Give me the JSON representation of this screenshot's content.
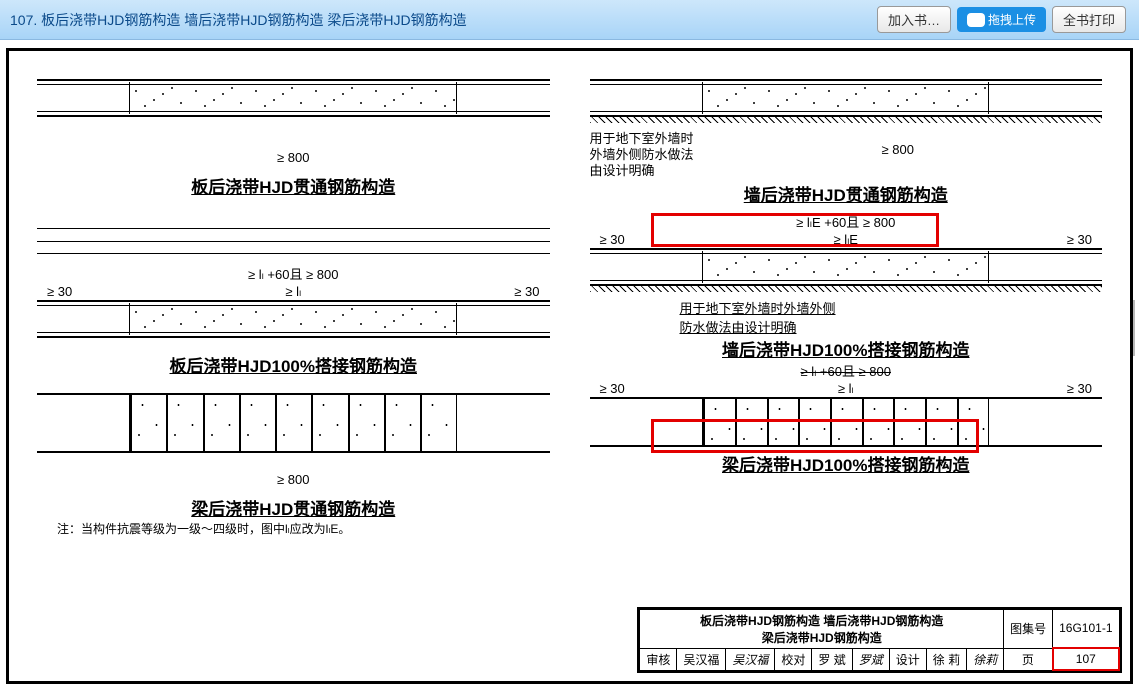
{
  "toolbar": {
    "title": "107.  板后浇带HJD钢筋构造   墙后浇带HJD钢筋构造   梁后浇带HJD钢筋构造",
    "add_label": "加入书…",
    "cloud_label": "拖拽上传",
    "print_label": "全书打印"
  },
  "left": {
    "dim_800": "≥ 800",
    "title1": "板后浇带HJD贯通钢筋构造",
    "dim_ll60800": "≥ lₗ +60且 ≥ 800",
    "dim_ll": "≥ lₗ",
    "dim_30a": "≥ 30",
    "dim_30b": "≥ 30",
    "title2": "板后浇带HJD100%搭接钢筋构造",
    "dim_800b": "≥ 800",
    "title3": "梁后浇带HJD贯通钢筋构造",
    "footnote": "注：当构件抗震等级为一级～四级时，图中lₗ应改为lₗE。"
  },
  "right": {
    "note1a": "用于地下室外墙时",
    "note1b": "外墙外侧防水做法",
    "note1c": "由设计明确",
    "dim_800": "≥ 800",
    "title1": "墙后浇带HJD贯通钢筋构造",
    "dim_llE60800": "≥ lₗE +60且 ≥ 800",
    "dim_llE": "≥ lₗE",
    "dim_30a": "≥ 30",
    "dim_30b": "≥ 30",
    "note2a": "用于地下室外墙时外墙外侧",
    "note2b": "防水做法由设计明确",
    "title2": "墙后浇带HJD100%搭接钢筋构造",
    "dim_ll60800b": "≥ lₗ +60且 ≥ 800",
    "dim_ll": "≥ lₗ",
    "dim_30c": "≥ 30",
    "dim_30d": "≥ 30",
    "title3": "梁后浇带HJD100%搭接钢筋构造"
  },
  "title_block": {
    "row1a": "板后浇带HJD钢筋构造    墙后浇带HJD钢筋构造",
    "row1b": "梁后浇带HJD钢筋构造",
    "atlas_label": "图集号",
    "atlas_val": "16G101-1",
    "审核": "审核",
    "吴汉福": "吴汉福",
    "吴汉福sig": "吴汉福",
    "校对": "校对",
    "罗斌": "罗 斌",
    "罗斌sig": "罗斌",
    "设计": "设计",
    "徐莉": "徐 莉",
    "徐莉sig": "徐莉",
    "页": "页",
    "页val": "107"
  }
}
